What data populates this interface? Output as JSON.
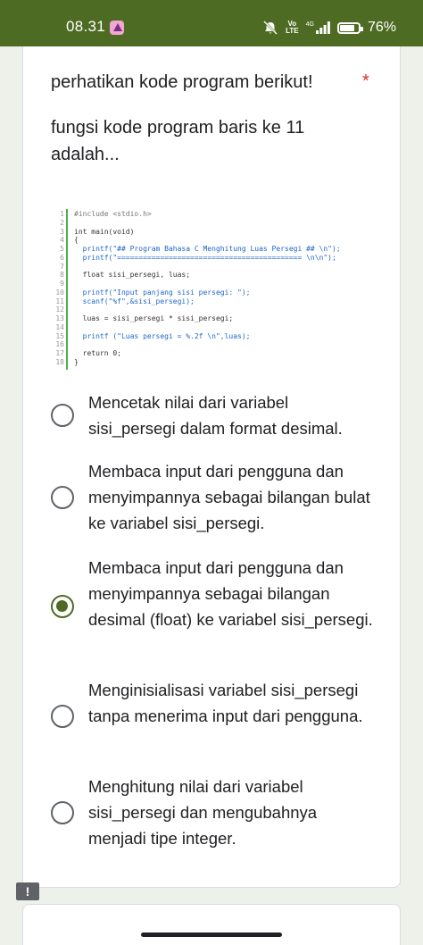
{
  "status_bar": {
    "time": "08.31",
    "app_icon": "pink-app-icon",
    "volte": "Vo\nLTE",
    "network": "4G",
    "battery_percent": "76%"
  },
  "question": {
    "title": "perhatikan kode program berikut!",
    "required_marker": "*",
    "description": "fungsi kode program baris ke 11 adalah..."
  },
  "code": {
    "line_numbers": [
      "1",
      "2",
      "3",
      "4",
      "5",
      "6",
      "7",
      "8",
      "9",
      "10",
      "11",
      "12",
      "13",
      "14",
      "15",
      "16",
      "17",
      "18"
    ],
    "lines": [
      "#include <stdio.h>",
      "",
      "int main(void)",
      "{",
      "  printf(\"## Program Bahasa C Menghitung Luas Persegi ## \\n\");",
      "  printf(\"=========================================== \\n\\n\");",
      "",
      "  float sisi_persegi, luas;",
      "",
      "  printf(\"Input panjang sisi persegi: \");",
      "  scanf(\"%f\",&sisi_persegi);",
      "",
      "  luas = sisi_persegi * sisi_persegi;",
      "",
      "  printf (\"Luas persegi = %.2f \\n\",luas);",
      "",
      "  return 0;",
      "}"
    ]
  },
  "options": [
    {
      "label": "Mencetak nilai dari variabel sisi_persegi dalam format desimal.",
      "checked": false
    },
    {
      "label": "Membaca input dari pengguna dan menyimpannya sebagai bilangan bulat ke variabel sisi_persegi.",
      "checked": false
    },
    {
      "label": "Membaca input dari pengguna dan menyimpannya sebagai bilangan desimal (float) ke variabel sisi_persegi.",
      "checked": true
    },
    {
      "label": "Menginisialisasi variabel sisi_persegi tanpa menerima input dari pengguna.",
      "checked": false
    },
    {
      "label": "Menghitung nilai dari variabel sisi_persegi dan mengubahnya menjadi tipe integer.",
      "checked": false
    }
  ],
  "report_icon": "!",
  "colors": {
    "theme": "#4e6b23",
    "page_bg": "#eef0ea",
    "required": "#d93025",
    "code_gutter_bar": "#4caf50"
  }
}
